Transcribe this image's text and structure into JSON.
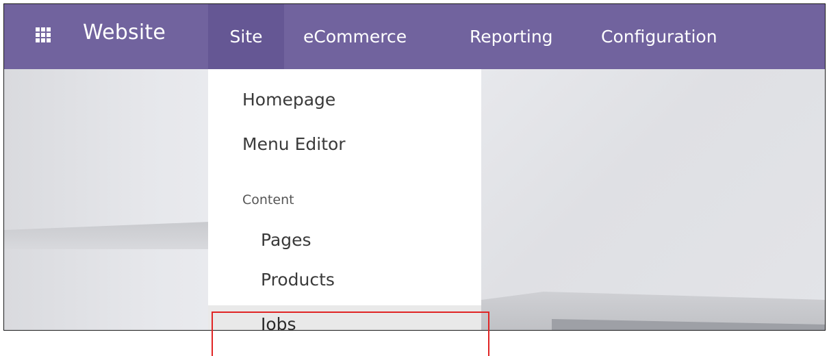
{
  "navbar": {
    "app_name": "Website",
    "apps_icon": "grid-apps-icon",
    "items": [
      {
        "label": "Site",
        "active": true
      },
      {
        "label": "eCommerce"
      },
      {
        "label": "Reporting"
      },
      {
        "label": "Configuration"
      }
    ],
    "background_color": "#71639e"
  },
  "dropdown": {
    "items": [
      {
        "label": "Homepage"
      },
      {
        "label": "Menu Editor"
      }
    ],
    "section_header": "Content",
    "content_items": [
      {
        "label": "Pages"
      },
      {
        "label": "Products"
      },
      {
        "label": "Jobs",
        "highlighted": true
      }
    ]
  },
  "annotation": {
    "highlight_color": "#e02424",
    "target": "Jobs"
  }
}
